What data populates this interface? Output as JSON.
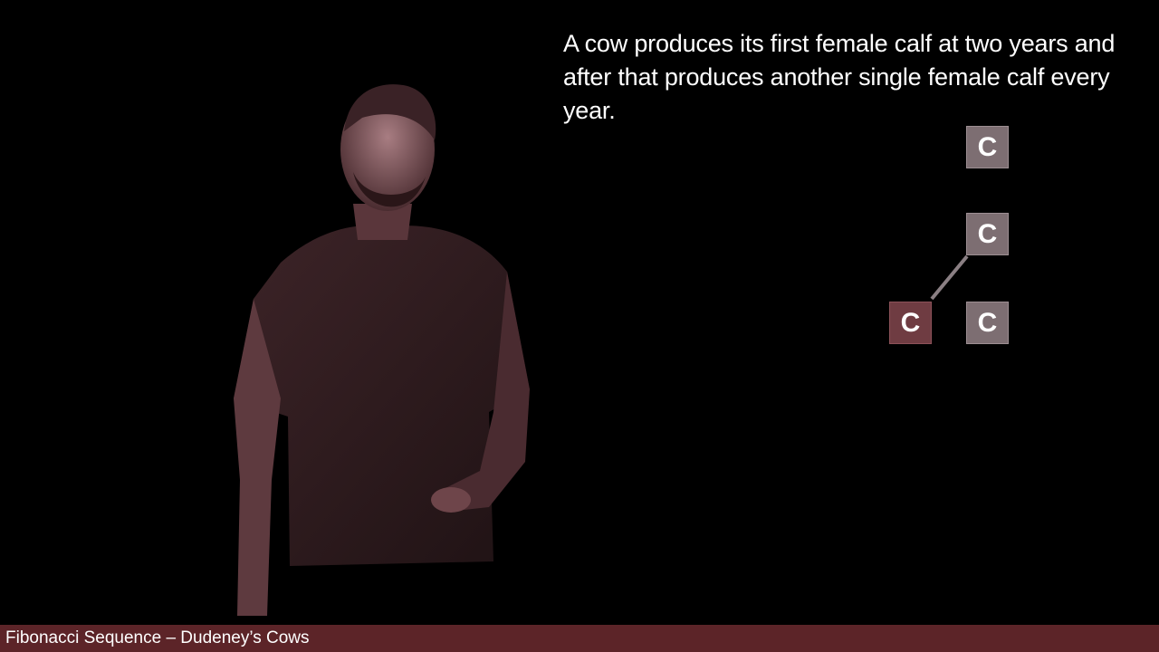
{
  "slide": {
    "problem_text": "A cow produces its first female calf at two years and after that produces another single female calf every year."
  },
  "tree": {
    "nodes": [
      {
        "label": "C",
        "role": "year-1-cow"
      },
      {
        "label": "C",
        "role": "year-2-cow"
      },
      {
        "label": "C",
        "role": "year-3-calf"
      },
      {
        "label": "C",
        "role": "year-3-cow"
      }
    ],
    "colors": {
      "cow": "#7d6e72",
      "calf": "#6f3c42",
      "connector": "#8a7f83"
    }
  },
  "footer": {
    "title": "Fibonacci Sequence – Dudeney’s Cows",
    "background": "#5c2428"
  }
}
